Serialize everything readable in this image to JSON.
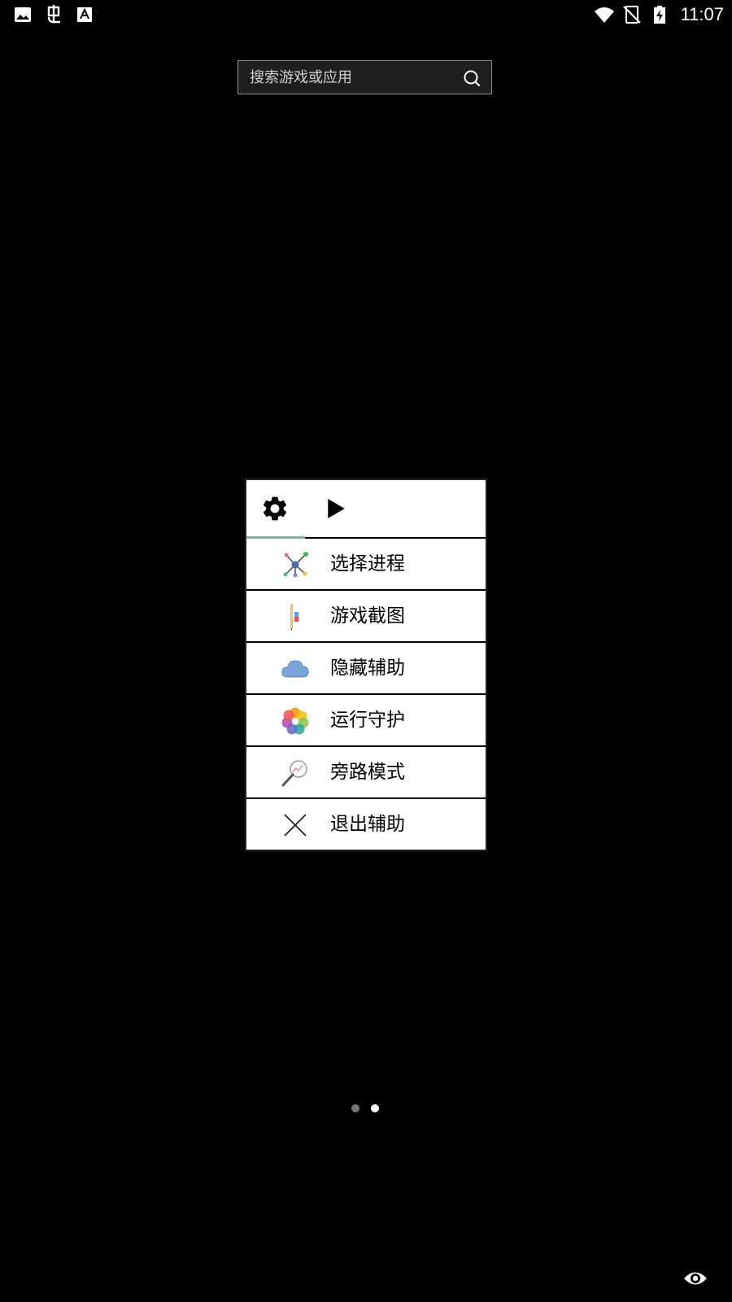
{
  "status_bar": {
    "time": "11:07",
    "left_icons": [
      "image-icon",
      "bug-icon",
      "font-icon"
    ],
    "right_icons": [
      "wifi-icon",
      "no-signal-icon",
      "battery-charging-icon"
    ]
  },
  "search": {
    "placeholder": "搜索游戏或应用"
  },
  "menu": {
    "tabs": [
      {
        "icon": "gear-icon",
        "active": true
      },
      {
        "icon": "play-icon",
        "active": false
      }
    ],
    "items": [
      {
        "label": "选择进程",
        "icon": "process-network-icon"
      },
      {
        "label": "游戏截图",
        "icon": "screenshot-icon"
      },
      {
        "label": "隐藏辅助",
        "icon": "cloud-icon"
      },
      {
        "label": "运行守护",
        "icon": "flower-icon"
      },
      {
        "label": "旁路模式",
        "icon": "magnifier-chart-icon"
      },
      {
        "label": "退出辅助",
        "icon": "close-icon"
      }
    ],
    "accent_color": "#7ab8a8"
  },
  "pager": {
    "total": 2,
    "active_index": 1
  }
}
